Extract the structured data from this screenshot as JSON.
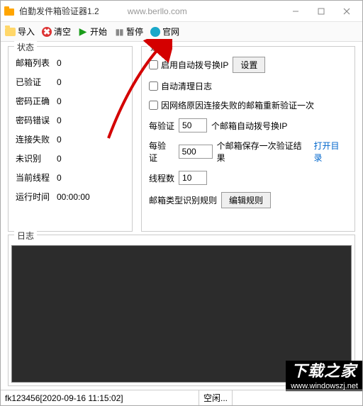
{
  "titlebar": {
    "app_title": "伯勤发件箱验证器1.2",
    "url": "www.berllo.com"
  },
  "toolbar": {
    "import": "导入",
    "clear": "清空",
    "start": "开始",
    "pause": "暂停",
    "website": "官网"
  },
  "status": {
    "panel_title": "状态",
    "rows": {
      "mailbox_list_label": "邮箱列表",
      "mailbox_list_value": "0",
      "verified_label": "已验证",
      "verified_value": "0",
      "pw_correct_label": "密码正确",
      "pw_correct_value": "0",
      "pw_wrong_label": "密码错误",
      "pw_wrong_value": "0",
      "conn_fail_label": "连接失败",
      "conn_fail_value": "0",
      "unknown_label": "未识别",
      "unknown_value": "0",
      "threads_label": "当前线程",
      "threads_value": "0",
      "runtime_label": "运行时间",
      "runtime_value": "00:00:00"
    }
  },
  "options": {
    "panel_title": "选项",
    "auto_dial_label": "启用自动拨号换IP",
    "settings_button": "设置",
    "auto_clean_log_label": "自动清理日志",
    "retry_net_fail_label": "因网络原因连接失败的邮箱重新验证一次",
    "every_verify_label": "每验证",
    "dial_count_value": "50",
    "dial_suffix": "个邮箱自动拨号换IP",
    "save_count_value": "500",
    "save_suffix": "个邮箱保存一次验证结果",
    "open_dir_link": "打开目录",
    "thread_count_label": "线程数",
    "thread_count_value": "10",
    "rule_label": "邮箱类型识别规则",
    "edit_rule_button": "编辑规则"
  },
  "log": {
    "panel_title": "日志"
  },
  "watermark": {
    "text": "下载之家",
    "url": "www.windowszj.net"
  },
  "statusbar": {
    "left": "fk123456[2020-09-16 11:15:02]",
    "right": "空闲..."
  }
}
